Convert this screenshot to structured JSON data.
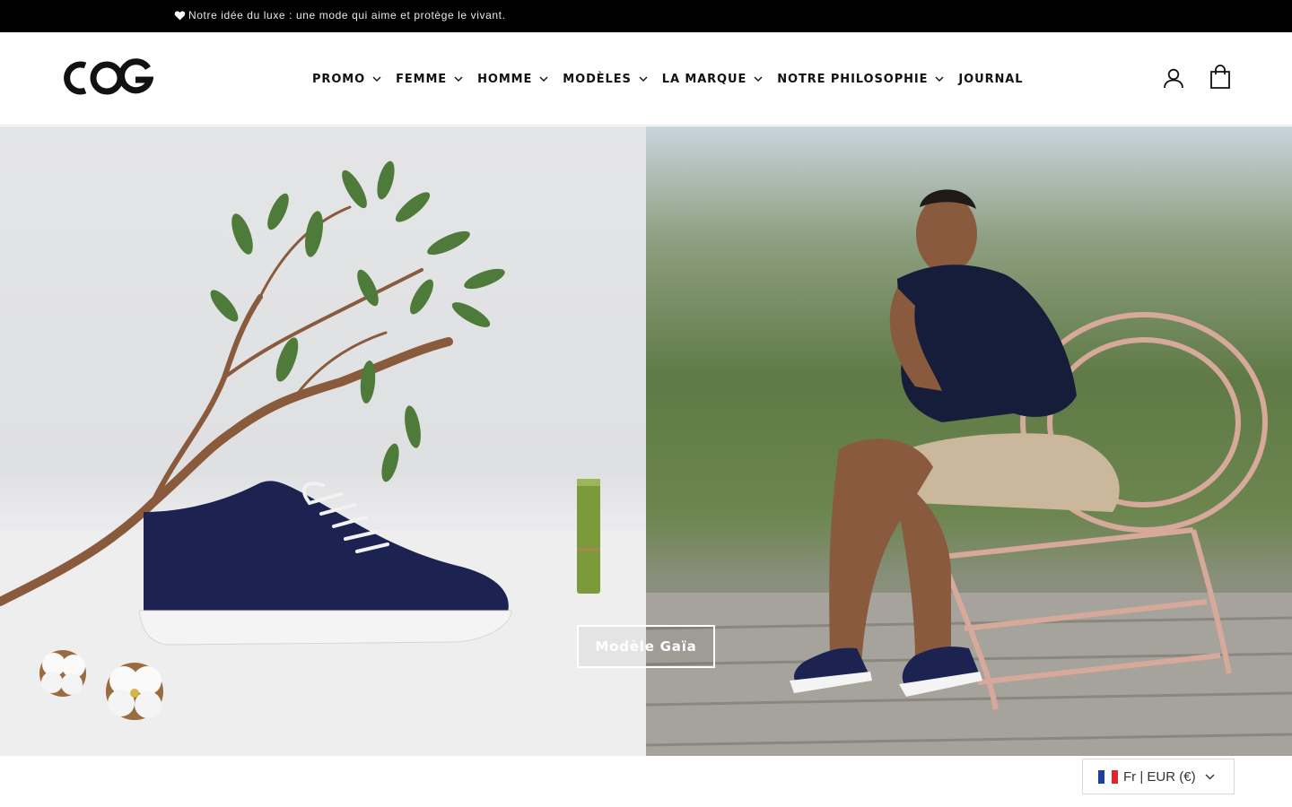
{
  "announcement": {
    "icon": "heart-icon",
    "text": "Notre idée du luxe : une mode qui aime et protège le vivant."
  },
  "header": {
    "logo_text": "COG",
    "nav": [
      {
        "label": "PROMO",
        "has_dropdown": true
      },
      {
        "label": "FEMME",
        "has_dropdown": true
      },
      {
        "label": "HOMME",
        "has_dropdown": true
      },
      {
        "label": "MODÈLES",
        "has_dropdown": true
      },
      {
        "label": "LA MARQUE",
        "has_dropdown": true
      },
      {
        "label": "NOTRE PHILOSOPHIE",
        "has_dropdown": true
      },
      {
        "label": "JOURNAL",
        "has_dropdown": false
      }
    ],
    "icons": [
      "account-icon",
      "cart-icon"
    ]
  },
  "hero": {
    "cta_label": "Modèle Gaïa",
    "left_image": "navy sneaker with eucalyptus branch, bamboo and cotton flowers",
    "right_image": "man seated in wicker chair wearing navy sneakers"
  },
  "currency_selector": {
    "label": "Fr | EUR (€)",
    "flag": "france-flag-icon"
  },
  "colors": {
    "announcement_bg": "#000000",
    "sneaker_navy": "#1c2350",
    "background": "#ffffff"
  }
}
